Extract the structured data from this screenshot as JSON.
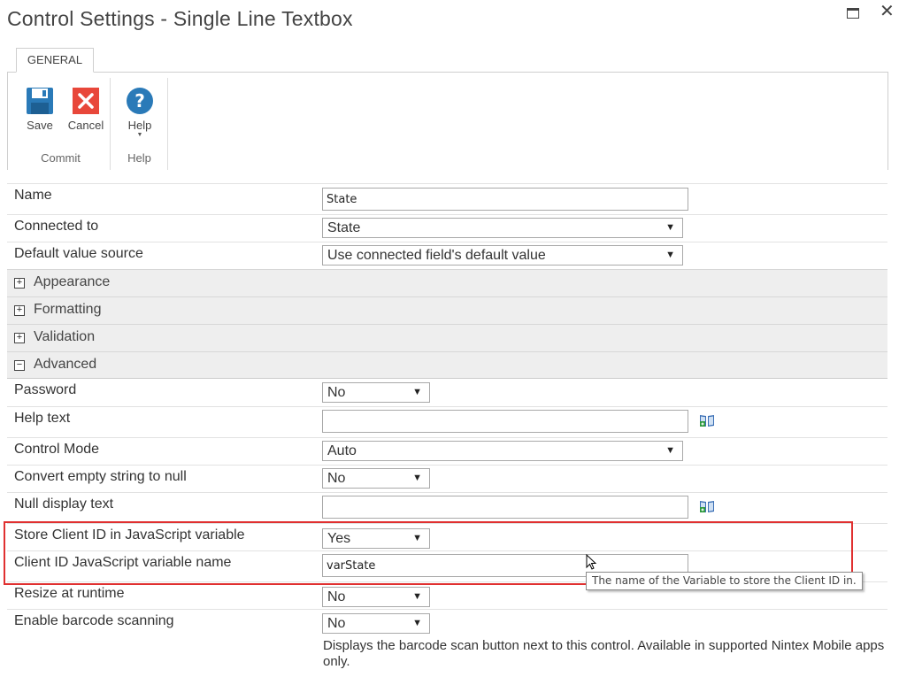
{
  "window": {
    "title": "Control Settings - Single Line Textbox",
    "maximize_glyph": "",
    "close_glyph": "✕"
  },
  "ribbon": {
    "tabs": [
      {
        "label": "GENERAL"
      }
    ],
    "groups": {
      "commit": {
        "label": "Commit",
        "save_label": "Save",
        "cancel_label": "Cancel"
      },
      "help": {
        "label": "Help",
        "help_label": "Help"
      }
    }
  },
  "form": {
    "name": {
      "label": "Name",
      "value": "State"
    },
    "connected_to": {
      "label": "Connected to",
      "value": "State"
    },
    "default_value_source": {
      "label": "Default value source",
      "value": "Use connected field's default value"
    },
    "sections": {
      "appearance": {
        "label": "Appearance",
        "toggle": "+"
      },
      "formatting": {
        "label": "Formatting",
        "toggle": "+"
      },
      "validation": {
        "label": "Validation",
        "toggle": "+"
      },
      "advanced": {
        "label": "Advanced",
        "toggle": "−"
      }
    },
    "password": {
      "label": "Password",
      "value": "No"
    },
    "help_text": {
      "label": "Help text",
      "value": ""
    },
    "control_mode": {
      "label": "Control Mode",
      "value": "Auto"
    },
    "convert_empty": {
      "label": "Convert empty string to null",
      "value": "No"
    },
    "null_display_text": {
      "label": "Null display text",
      "value": ""
    },
    "store_client_id": {
      "label": "Store Client ID in JavaScript variable",
      "value": "Yes"
    },
    "client_id_var_name": {
      "label": "Client ID JavaScript variable name",
      "value": "varState"
    },
    "resize_at_runtime": {
      "label": "Resize at runtime",
      "value": "No"
    },
    "enable_barcode": {
      "label": "Enable barcode scanning",
      "value": "No",
      "description": "Displays the barcode scan button next to this control. Available in supported Nintex Mobile apps only."
    }
  },
  "tooltip": {
    "text": "The name of the Variable to store the Client ID in."
  },
  "icons": {
    "save": "save-icon",
    "cancel": "cancel-icon",
    "help": "help-icon",
    "insert_reference": "insert-reference-icon",
    "dropdown": "▼"
  },
  "colors": {
    "highlight": "#e03030",
    "save_blue": "#2a7ab8",
    "cancel_red": "#e8473a",
    "help_blue": "#2a7ab8",
    "section_bg": "#eeeeee"
  }
}
